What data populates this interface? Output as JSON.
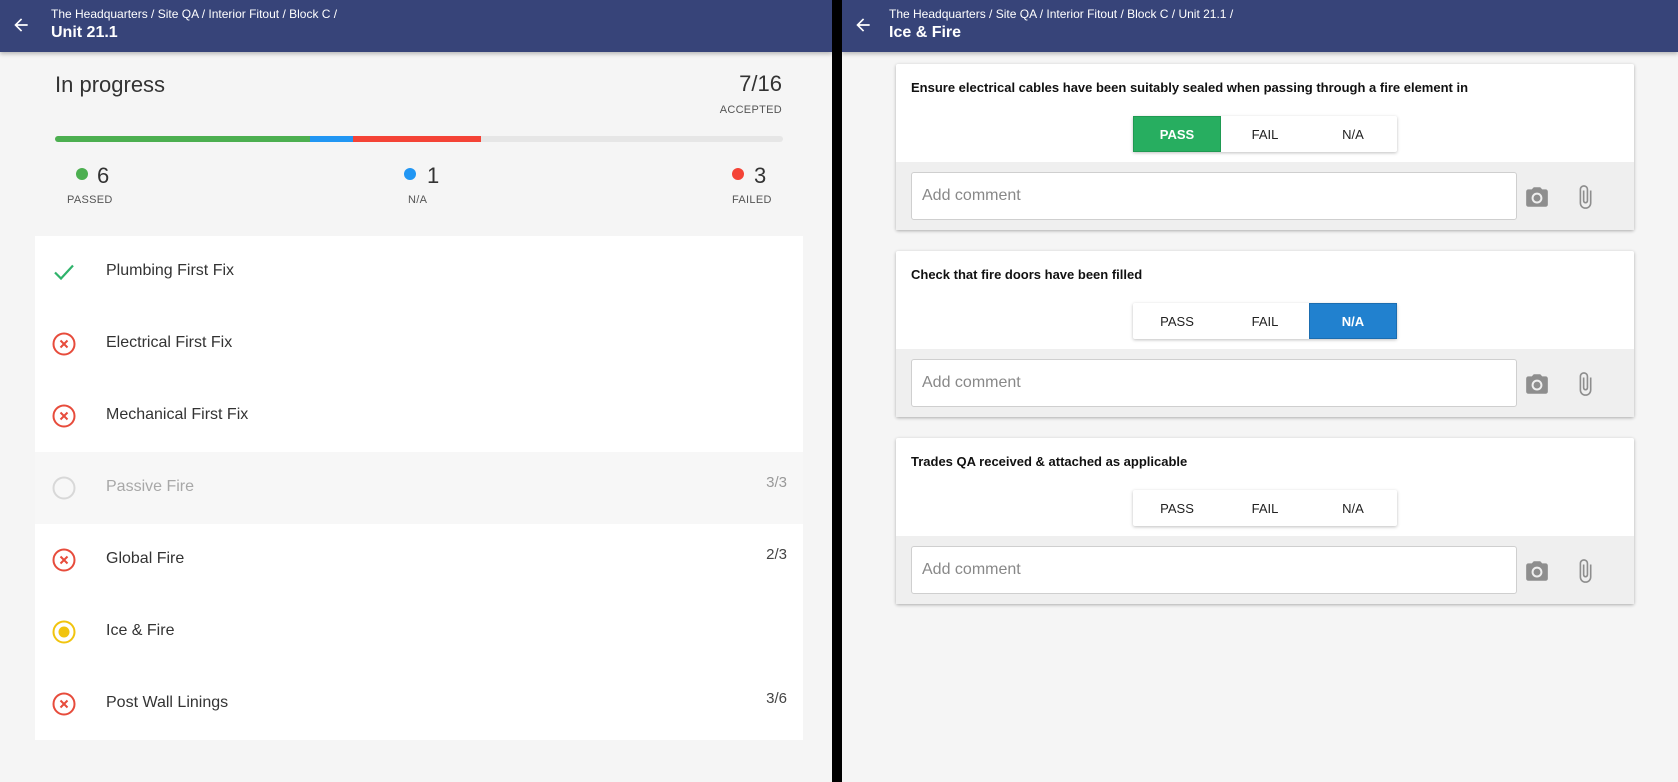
{
  "left": {
    "breadcrumb": "The Headquarters / Site QA / Interior Fitout / Block C /",
    "title": "Unit 21.1",
    "status": "In progress",
    "accepted_count": "7/16",
    "accepted_label": "ACCEPTED",
    "progress": {
      "passed_fraction": 0.35,
      "na_fraction": 0.06,
      "failed_fraction": 0.175
    },
    "colors": {
      "passed": "#4caf50",
      "na": "#2196f3",
      "failed": "#f44336",
      "header": "#374479"
    },
    "stats": {
      "passed": {
        "value": "6",
        "label": "PASSED"
      },
      "na": {
        "value": "1",
        "label": "N/A"
      },
      "failed": {
        "value": "3",
        "label": "FAILED"
      }
    },
    "items": [
      {
        "label": "Plumbing First Fix",
        "status": "passed",
        "count": ""
      },
      {
        "label": "Electrical First Fix",
        "status": "failed",
        "count": ""
      },
      {
        "label": "Mechanical First Fix",
        "status": "failed",
        "count": ""
      },
      {
        "label": "Passive Fire",
        "status": "disabled",
        "count": "3/3"
      },
      {
        "label": "Global Fire",
        "status": "failed",
        "count": "2/3"
      },
      {
        "label": "Ice & Fire",
        "status": "in-progress",
        "count": ""
      },
      {
        "label": "Post Wall Linings",
        "status": "failed",
        "count": "3/6"
      }
    ]
  },
  "right": {
    "breadcrumb": "The Headquarters / Site QA / Interior Fitout / Block C / Unit 21.1 /",
    "title": "Ice & Fire",
    "options": {
      "pass": "PASS",
      "fail": "FAIL",
      "na": "N/A"
    },
    "comment_placeholder": "Add comment",
    "questions": [
      {
        "text": "Ensure electrical cables have been suitably sealed when passing through a fire element in",
        "selected": "PASS"
      },
      {
        "text": "Check that fire doors have been filled",
        "selected": "N/A"
      },
      {
        "text": "Trades QA received & attached as applicable",
        "selected": ""
      }
    ]
  }
}
